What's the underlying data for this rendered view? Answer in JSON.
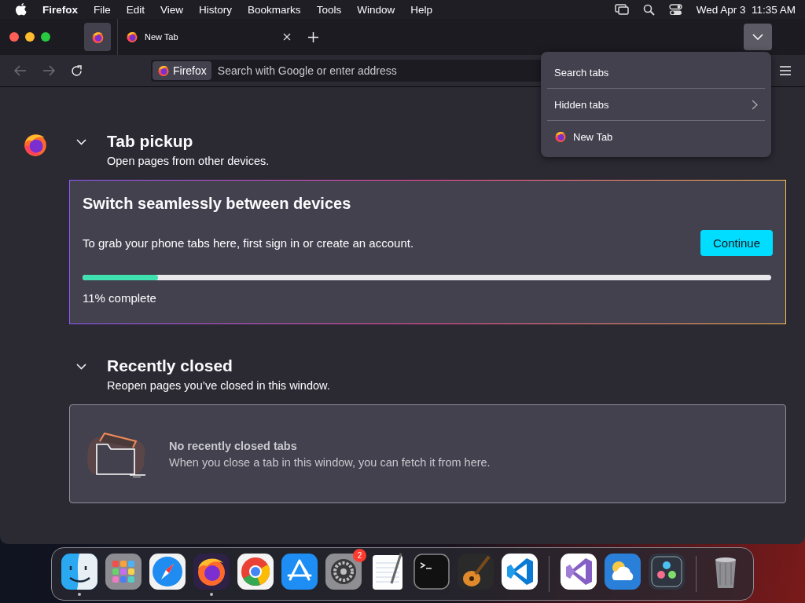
{
  "menu_bar": {
    "app": "Firefox",
    "items": [
      "File",
      "Edit",
      "View",
      "History",
      "Bookmarks",
      "Tools",
      "Window",
      "Help"
    ],
    "clock": "Wed Apr 3  11:35 AM"
  },
  "tabs": [
    {
      "label": "New Tab"
    }
  ],
  "url_bar": {
    "identity": "Firefox",
    "placeholder": "Search with Google or enter address"
  },
  "tab_menu": [
    {
      "label": "Search tabs",
      "kind": "action"
    },
    {
      "label": "Hidden tabs",
      "kind": "submenu"
    },
    {
      "label": "New Tab",
      "kind": "tab"
    }
  ],
  "sections": [
    {
      "title": "Tab pickup",
      "subtitle": "Open pages from other devices.",
      "expanded": true,
      "card": {
        "kind": "setup",
        "heading": "Switch seamlessly between devices",
        "text": "To grab your phone tabs here, first sign in or create an account.",
        "button": "Continue",
        "level": 0.11,
        "progress": "11% complete"
      }
    },
    {
      "title": "Recently closed",
      "subtitle": "Reopen pages you’ve closed in this window.",
      "expanded": true,
      "card": {
        "kind": "empty",
        "heading": "No recently closed tabs",
        "text": "When you close a tab in this window, you can fetch it from here."
      }
    }
  ],
  "dock": [
    {
      "kind": "face",
      "running": true
    },
    {
      "kind": "grid",
      "running": false
    },
    {
      "kind": "compass",
      "running": false
    },
    {
      "kind": "fox",
      "running": true
    },
    {
      "kind": "ring",
      "running": false
    },
    {
      "kind": "triangle",
      "running": false
    },
    {
      "kind": "gear",
      "running": false,
      "badge": "2"
    },
    {
      "kind": "notepad",
      "running": false
    },
    {
      "kind": "terminal",
      "running": false
    },
    {
      "kind": "guitar",
      "running": false
    },
    {
      "kind": "code",
      "running": false
    },
    {
      "kind": "separator"
    },
    {
      "kind": "code-purple",
      "running": false
    },
    {
      "kind": "cloud",
      "running": false
    },
    {
      "kind": "dots",
      "running": false
    },
    {
      "kind": "separator"
    },
    {
      "kind": "trash",
      "running": false
    }
  ]
}
